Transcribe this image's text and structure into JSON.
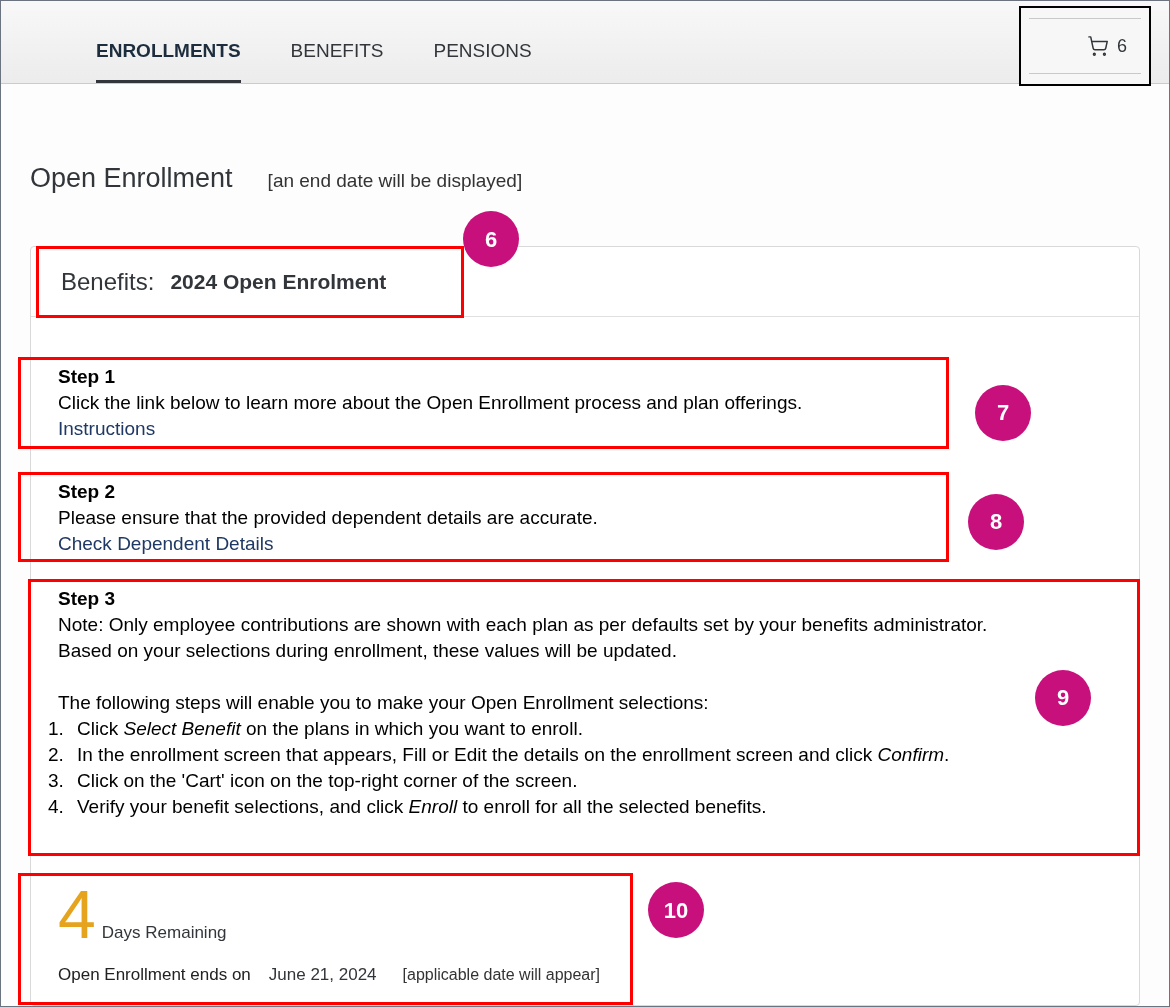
{
  "tabs": [
    {
      "label": "ENROLLMENTS",
      "selected": true
    },
    {
      "label": "BENEFITS",
      "selected": false
    },
    {
      "label": "PENSIONS",
      "selected": false
    }
  ],
  "cart": {
    "count": "6"
  },
  "page_title": "Open Enrollment",
  "title_note": "[an end date will be displayed]",
  "card": {
    "label": "Benefits:",
    "name": "2024 Open Enrolment",
    "callout": "6"
  },
  "steps": [
    {
      "title": "Step 1",
      "text": "Click the link below to learn more about the Open Enrollment process and plan offerings.",
      "link": "Instructions",
      "callout": "7"
    },
    {
      "title": "Step 2",
      "text": "Please ensure that the provided dependent details are accurate.",
      "link": "Check Dependent Details",
      "callout": "8"
    }
  ],
  "step3": {
    "title": "Step 3",
    "note": "Note: Only employee contributions are shown with each plan as per defaults set by your benefits administrator.",
    "update": "Based on your selections during enrollment, these values will be updated.",
    "intro": "The following steps will enable you to make your Open Enrollment selections:",
    "callout": "9",
    "items": [
      {
        "number": "1.",
        "text": "Click *Select Benefit* on the plans in which you want to enroll."
      },
      {
        "number": "2.",
        "text": "In the enrollment screen that appears, Fill or Edit the details on the enrollment screen and click *Confirm*."
      },
      {
        "number": "3.",
        "text": "Click on the 'Cart' icon on the top-right corner of the screen."
      },
      {
        "number": "4.",
        "text": "Verify your benefit selections, and click *Enroll* to enroll for all the selected benefits."
      }
    ]
  },
  "countdown": {
    "days": "4",
    "days_label": "Days Remaining",
    "ends_label": "Open Enrollment ends on",
    "ends_date": "June 21, 2024",
    "note": "[applicable date will appear]",
    "callout": "10"
  }
}
